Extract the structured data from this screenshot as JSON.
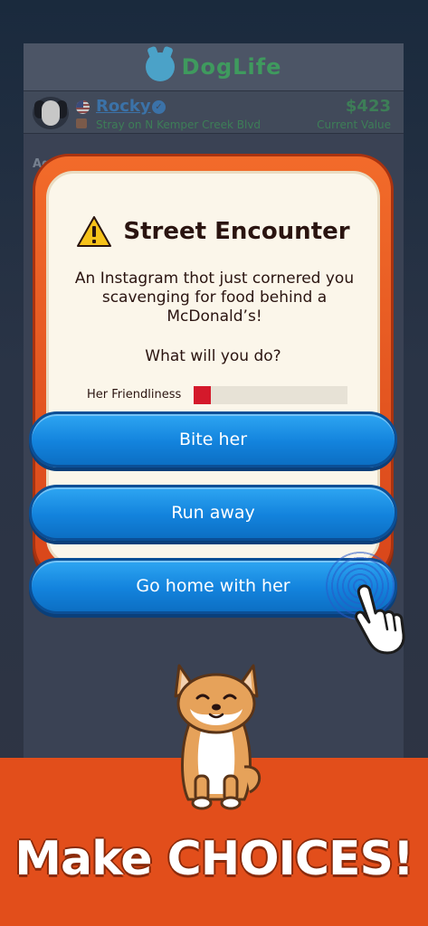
{
  "app": {
    "title": "DogLife"
  },
  "profile": {
    "name": "Rocky",
    "status": "Stray on N Kemper Creek Blvd",
    "value": "$423",
    "value_label": "Current Value"
  },
  "background": {
    "age_label": "Age"
  },
  "modal": {
    "title": "Street Encounter",
    "message": "An Instagram thot just cornered you scavenging for food behind a McDonald’s!",
    "question": "What will you do?",
    "meter_label": "Her Friendliness",
    "meter_value": 0.11,
    "meter_color": "#d4192b"
  },
  "choices": [
    {
      "label": "Bite her"
    },
    {
      "label": "Run away"
    },
    {
      "label": "Go home with her"
    }
  ],
  "promo": {
    "text": "Make CHOICES!"
  },
  "colors": {
    "frame": "#e35a22",
    "button": "#1a8ae6",
    "bottom_bar": "#e24e1b"
  },
  "icons": [
    "doglife-logo-icon",
    "dalmatian-avatar-icon",
    "us-flag-icon",
    "verified-icon",
    "box-icon",
    "warning-icon",
    "pointing-hand-icon",
    "shiba-dog-icon"
  ]
}
